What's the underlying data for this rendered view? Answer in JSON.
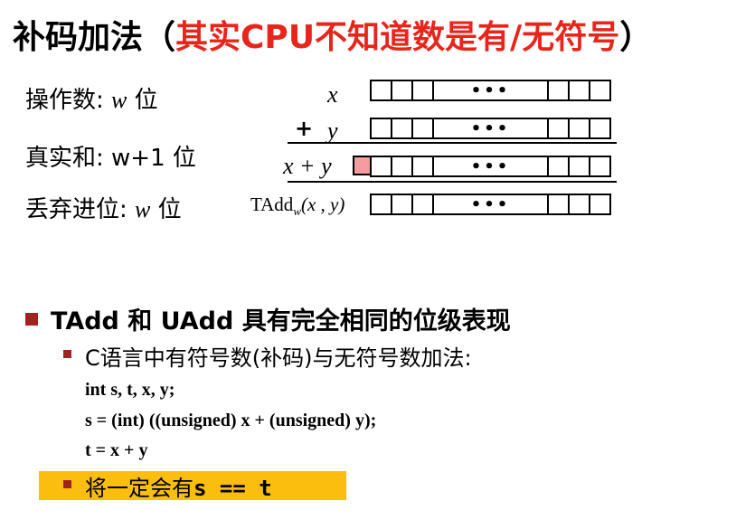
{
  "title": {
    "main": "补码加法（",
    "accent": "其实CPU不知道数是有/无符号",
    "close": "）"
  },
  "labels": [
    {
      "text": "操作数:",
      "var": "w",
      "unit": "位"
    },
    {
      "text": "真实和:",
      "var": "w+1",
      "unit": "位"
    },
    {
      "text": "丢弃进位:",
      "var": "w",
      "unit": "位"
    }
  ],
  "operands": {
    "x": "x",
    "plus": "+",
    "y": "y",
    "sum": "x + y",
    "tadd_name": "TAdd",
    "tadd_sub": "w",
    "tadd_args": "(x , y)"
  },
  "dots": "•••",
  "bullets": {
    "main": "TAdd 和 UAdd 具有完全相同的位级表现",
    "sub": "C语言中有符号数(补码)与无符号数加法:",
    "code": [
      "int s, t, x, y;",
      "s = (int) ((unsigned) x + (unsigned) y);",
      "t = x + y"
    ],
    "conclusion_prefix": "将一定会有",
    "conclusion_code": "s == t"
  },
  "colors": {
    "accent": "#e8251b",
    "bullet": "#a0231f",
    "highlight": "#fbbe0f",
    "carry": "#f59c9e"
  }
}
